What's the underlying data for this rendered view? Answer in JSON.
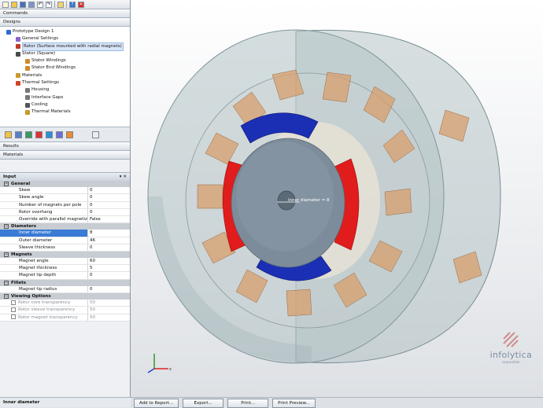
{
  "left_panel": {
    "commands_label": "Commands",
    "designs_label": "Designs",
    "results_label": "Results",
    "materials_label": "Materials",
    "tree": [
      {
        "label": "Prototype Design 1",
        "indent": 0,
        "icon": "design-icon",
        "color": "#2f6bd6",
        "selected": false
      },
      {
        "label": "General Settings",
        "indent": 1,
        "icon": "settings-icon",
        "color": "#8a62c9",
        "selected": false
      },
      {
        "label": "Rotor (Surface mounted with radial magnets)",
        "indent": 1,
        "icon": "rotor-icon",
        "color": "#c03a2b",
        "selected": true
      },
      {
        "label": "Stator (Square)",
        "indent": 1,
        "icon": "stator-icon",
        "color": "#4a4a4a",
        "selected": false
      },
      {
        "label": "Stator Windings",
        "indent": 2,
        "icon": "windings-icon",
        "color": "#d08a2e",
        "selected": false
      },
      {
        "label": "Stator End Windings",
        "indent": 2,
        "icon": "end-windings-icon",
        "color": "#d08a2e",
        "selected": false
      },
      {
        "label": "Materials",
        "indent": 1,
        "icon": "materials-icon",
        "color": "#c9992a",
        "selected": false
      },
      {
        "label": "Thermal Settings",
        "indent": 1,
        "icon": "thermal-icon",
        "color": "#d04525",
        "selected": false
      },
      {
        "label": "Housing",
        "indent": 2,
        "icon": "housing-icon",
        "color": "#777",
        "selected": false
      },
      {
        "label": "Interface Gaps",
        "indent": 2,
        "icon": "gaps-icon",
        "color": "#777",
        "selected": false
      },
      {
        "label": "Cooling",
        "indent": 2,
        "icon": "cooling-icon",
        "color": "#555",
        "selected": false
      },
      {
        "label": "Thermal Materials",
        "indent": 2,
        "icon": "thermal-materials-icon",
        "color": "#c9992a",
        "selected": false
      }
    ],
    "input_title": "Input",
    "input_controls": "▾ ✕",
    "properties": [
      {
        "type": "cat",
        "label": "General"
      },
      {
        "type": "row",
        "key": "Skew",
        "value": "0"
      },
      {
        "type": "row",
        "key": "Skew angle",
        "value": "0"
      },
      {
        "type": "row",
        "key": "Number of magnets per pole",
        "value": "0"
      },
      {
        "type": "row",
        "key": "Rotor overhang",
        "value": "0"
      },
      {
        "type": "row",
        "key": "Override with parallel magnetization",
        "value": "False"
      },
      {
        "type": "cat",
        "label": "Diameters"
      },
      {
        "type": "row",
        "key": "Inner diameter",
        "value": "8",
        "selected": true
      },
      {
        "type": "row",
        "key": "Outer diameter",
        "value": "46"
      },
      {
        "type": "row",
        "key": "Sleeve thickness",
        "value": "0"
      },
      {
        "type": "cat",
        "label": "Magnets"
      },
      {
        "type": "row",
        "key": "Magnet angle",
        "value": "60"
      },
      {
        "type": "row",
        "key": "Magnet thickness",
        "value": "5"
      },
      {
        "type": "row",
        "key": "Magnet tip depth",
        "value": "0"
      },
      {
        "type": "cat",
        "label": "Fillets"
      },
      {
        "type": "row",
        "key": "Magnet tip radius",
        "value": "0"
      },
      {
        "type": "cat",
        "label": "Viewing Options"
      },
      {
        "type": "row",
        "key": "Rotor core transparency",
        "value": "50",
        "disabled": true
      },
      {
        "type": "row",
        "key": "Rotor sleeve transparency",
        "value": "50",
        "disabled": true
      },
      {
        "type": "row",
        "key": "Rotor magnet transparency",
        "value": "50",
        "disabled": true
      }
    ],
    "footer_label": "Inner diameter"
  },
  "viewport": {
    "tooltip": "Inner diameter = 8",
    "logo_name": "infolytica",
    "logo_sub": "corporation",
    "colors": {
      "magnet_red": "#e01c1c",
      "magnet_blue": "#1b2fb4",
      "rotor_core": "#7c8c9a",
      "winding": "#d8a170",
      "housing": "#a9bbbd"
    }
  },
  "buttons": [
    "Add to Report...",
    "Export...",
    "Print...",
    "Print Preview..."
  ]
}
